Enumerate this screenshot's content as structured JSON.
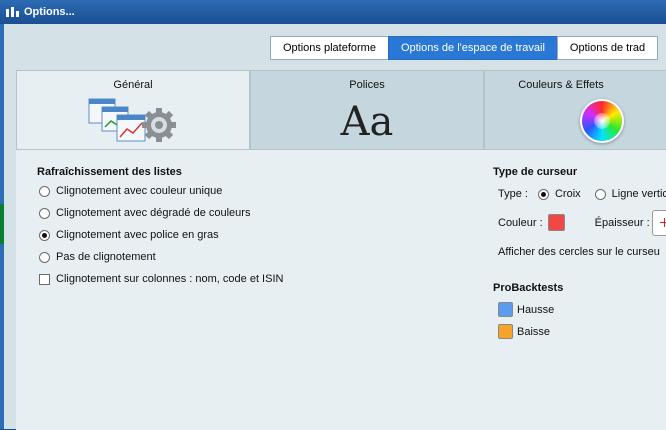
{
  "window": {
    "title": "Options..."
  },
  "top_tabs": [
    "Options plateforme",
    "Options de l'espace de travail",
    "Options de trad"
  ],
  "section_tabs": [
    "Général",
    "Polices",
    "Couleurs & Effets"
  ],
  "polices_preview": "Aa",
  "refresh": {
    "heading": "Rafraîchissement des listes",
    "options": [
      "Clignotement avec couleur unique",
      "Clignotement avec dégradé de couleurs",
      "Clignotement avec police en gras",
      "Pas de clignotement"
    ],
    "selected_index": 2,
    "columns_checkbox": "Clignotement sur colonnes : nom, code et ISIN",
    "columns_checked": false
  },
  "cursor": {
    "heading": "Type de curseur",
    "type_label": "Type :",
    "type_options": [
      "Croix",
      "Ligne vertic"
    ],
    "type_selected": "Croix",
    "color_label": "Couleur :",
    "color": "#f04747",
    "thickness_label": "Épaisseur :",
    "circles_label": "Afficher des cercles sur le curseu"
  },
  "probacktests": {
    "heading": "ProBacktests",
    "items": [
      {
        "label": "Hausse",
        "color": "#5b9cf0"
      },
      {
        "label": "Baisse",
        "color": "#f5a32a"
      }
    ]
  }
}
